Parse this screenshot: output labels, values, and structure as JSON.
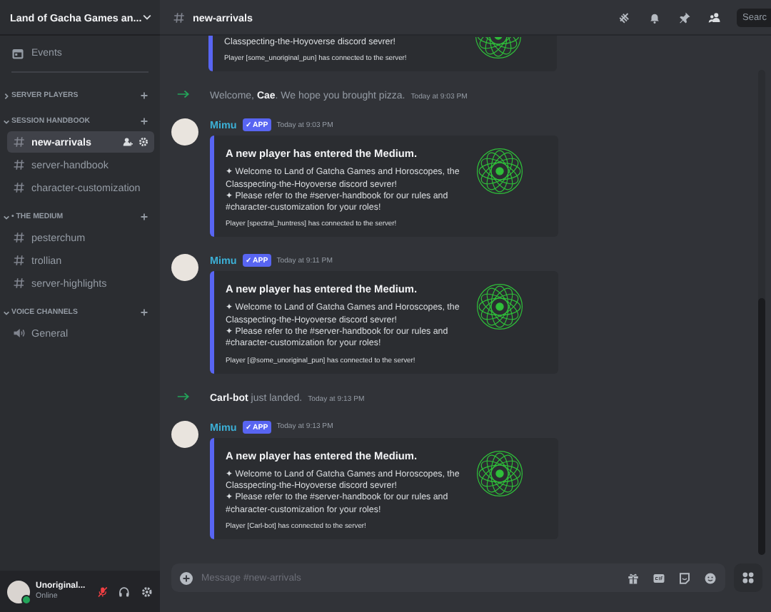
{
  "sidebar": {
    "server_name": "Land of Gacha Games an...",
    "events": "Events",
    "categories": [
      {
        "name": "SERVER PLAYERS",
        "expanded": false
      },
      {
        "name": "SESSION HANDBOOK",
        "expanded": true,
        "channels": [
          {
            "name": "new-arrivals",
            "kind": "text",
            "selected": true
          },
          {
            "name": "server-handbook",
            "kind": "text",
            "selected": false
          },
          {
            "name": "character-customization",
            "kind": "text",
            "selected": false
          }
        ]
      },
      {
        "name": "• THE MEDIUM",
        "expanded": true,
        "channels": [
          {
            "name": "pesterchum",
            "kind": "text",
            "selected": false
          },
          {
            "name": "trollian",
            "kind": "text",
            "selected": false
          },
          {
            "name": "server-highlights",
            "kind": "text",
            "selected": false
          }
        ]
      },
      {
        "name": "VOICE CHANNELS",
        "expanded": true,
        "channels": [
          {
            "name": "General",
            "kind": "voice",
            "selected": false
          }
        ]
      }
    ]
  },
  "user": {
    "name": "Unoriginal...",
    "status": "Online",
    "muted": true
  },
  "header": {
    "channel": "new-arrivals",
    "search_placeholder": "Searc"
  },
  "messages": [
    {
      "kind": "embed_tail",
      "lines": [
        "Classpecting-the-Hoyoverse discord sevrer!"
      ],
      "footer": "Player [some_unoriginal_pun] has connected to the server!"
    },
    {
      "kind": "join",
      "text": "Welcome, **Cae**. We hope you brought pizza.",
      "time": "Today at 9:03 PM"
    },
    {
      "kind": "bot",
      "author": "Mimu",
      "badge": "✓ APP",
      "time": "Today at 9:03 PM",
      "title": "A new player has entered the Medium.",
      "lines": [
        "✦ Welcome to Land of Gatcha Games and Horoscopes, the Classpecting-the-Hoyoverse discord sevrer!",
        "✦ Please refer to the #server-handbook for our rules and #character-customization for your roles!"
      ],
      "footer": "Player [spectral_huntress] has connected to the server!"
    },
    {
      "kind": "bot",
      "author": "Mimu",
      "badge": "✓ APP",
      "time": "Today at 9:11 PM",
      "title": "A new player has entered the Medium.",
      "lines": [
        "✦ Welcome to Land of Gatcha Games and Horoscopes, the Classpecting-the-Hoyoverse discord sevrer!",
        "✦ Please refer to the #server-handbook for our rules and #character-customization for your roles!"
      ],
      "footer": "Player [@some_unoriginal_pun] has connected to the server!"
    },
    {
      "kind": "join",
      "text": "**Carl-bot** just landed.",
      "time": "Today at 9:13 PM"
    },
    {
      "kind": "bot",
      "author": "Mimu",
      "badge": "✓ APP",
      "time": "Today at 9:13 PM",
      "title": "A new player has entered the Medium.",
      "lines": [
        "✦ Welcome to Land of Gatcha Games and Horoscopes, the Classpecting-the-Hoyoverse discord sevrer!",
        "✦ Please refer to the #server-handbook for our rules and #character-customization for your roles!"
      ],
      "footer": "Player [Carl-bot] has connected to the server!"
    }
  ],
  "composer": {
    "placeholder": "Message #new-arrivals"
  }
}
